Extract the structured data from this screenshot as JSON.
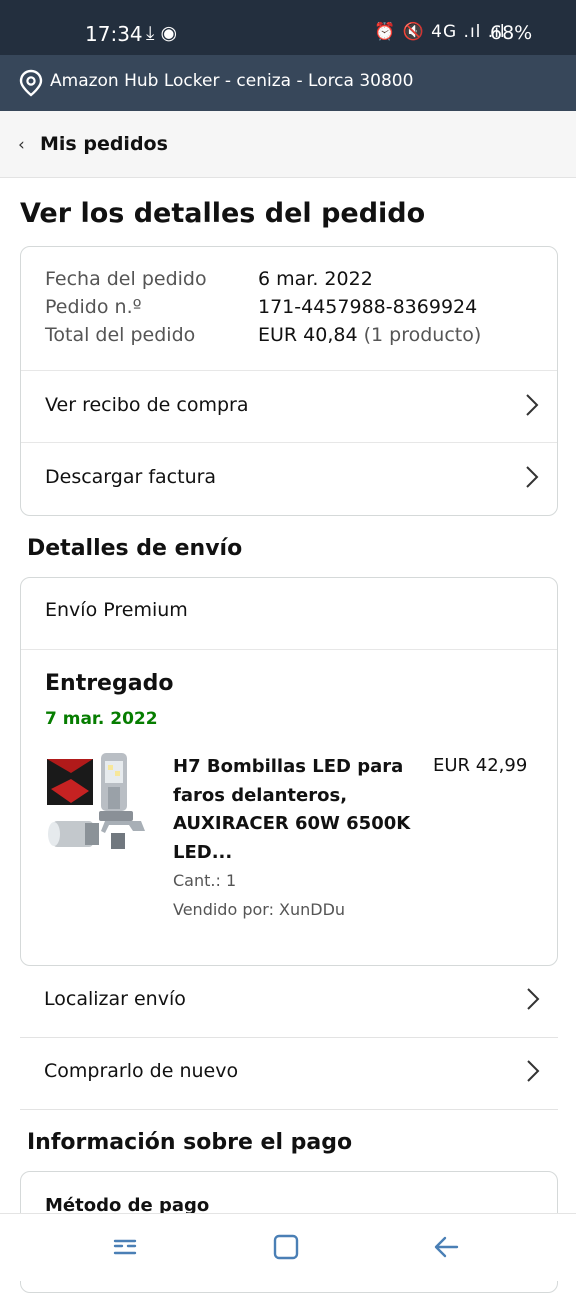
{
  "status_bar": {
    "time": "17:34",
    "left_icons": "⤓ ◉",
    "right_icons": "⏰ 🔇 4G .ıl .ıl",
    "battery": "68%"
  },
  "location": {
    "text": "Amazon Hub Locker - ceniza - Lorca 30800",
    "icon": "location-pin-icon"
  },
  "back": {
    "label": "Mis pedidos"
  },
  "page": {
    "title": "Ver los detalles del pedido"
  },
  "order": {
    "date_label": "Fecha del pedido",
    "date_value": "6 mar. 2022",
    "number_label": "Pedido n.º",
    "number_value": "171-4457988-8369924",
    "total_label": "Total del pedido",
    "total_value": "EUR 40,84",
    "total_count": "(1 producto)",
    "rows": [
      {
        "label": "Ver recibo de compra"
      },
      {
        "label": "Descargar factura"
      }
    ]
  },
  "shipping": {
    "title": "Detalles de envío",
    "method": "Envío Premium",
    "status": "Entregado",
    "status_date": "7 mar. 2022",
    "status_color": "#067d00",
    "product": {
      "name": "H7 Bombillas LED para faros delanteros, AUXIRACER 60W 6500K LED...",
      "price": "EUR 42,99",
      "quantity": "Cant.: 1",
      "seller": "Vendido por: XunDDu"
    },
    "rows": [
      {
        "label": "Localizar envío"
      },
      {
        "label": "Comprarlo de nuevo"
      }
    ]
  },
  "payment": {
    "title": "Información sobre el pago",
    "method_label": "Método de pago"
  },
  "colors": {
    "header_dark": "#232f3e",
    "header_light": "#37475a",
    "accent_green": "#067d00"
  }
}
